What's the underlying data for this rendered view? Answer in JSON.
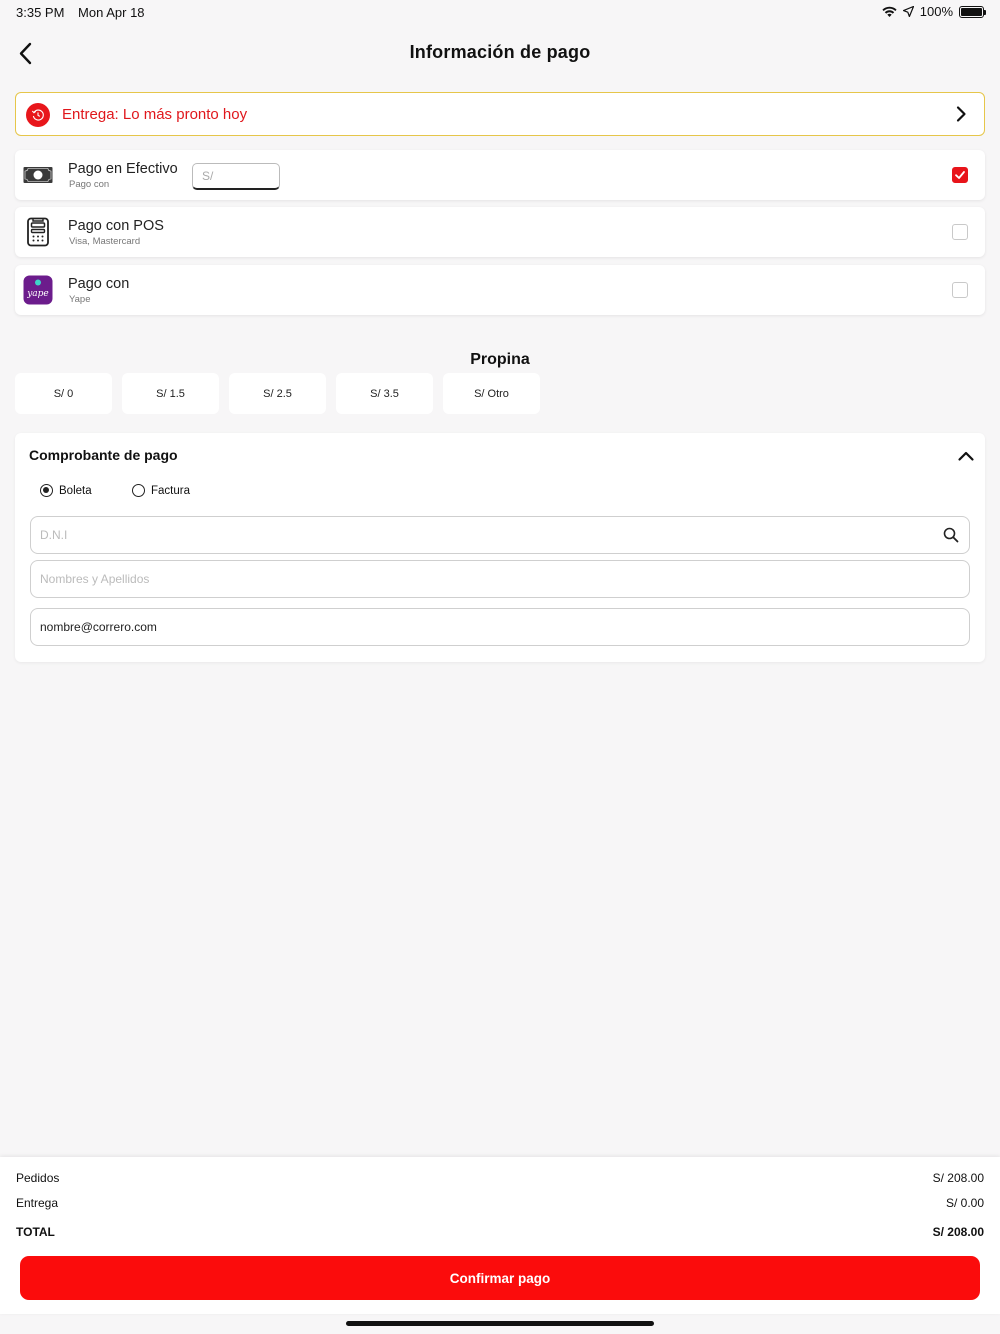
{
  "status": {
    "time": "3:35 PM",
    "date": "Mon Apr 18",
    "battery": "100%"
  },
  "nav": {
    "title": "Información de pago"
  },
  "delivery": {
    "label": "Entrega: Lo más pronto hoy"
  },
  "payment_methods": [
    {
      "title": "Pago en Efectivo",
      "subtitle": "Pago con",
      "checked": true,
      "input_placeholder": "S/"
    },
    {
      "title": "Pago con POS",
      "subtitle": "Visa, Mastercard",
      "checked": false
    },
    {
      "title": "Pago con",
      "subtitle": "Yape",
      "checked": false
    }
  ],
  "tip": {
    "title": "Propina",
    "options": [
      "S/ 0",
      "S/ 1.5",
      "S/ 2.5",
      "S/ 3.5",
      "S/ Otro"
    ]
  },
  "receipt": {
    "title": "Comprobante de pago",
    "options": [
      "Boleta",
      "Factura"
    ],
    "selected": "Boleta",
    "dni_placeholder": "D.N.I",
    "name_placeholder": "Nombres y Apellidos",
    "email_value": "nombre@correro.com"
  },
  "summary": {
    "orders_label": "Pedidos",
    "orders_value": "S/ 208.00",
    "delivery_label": "Entrega",
    "delivery_value": "S/ 0.00",
    "total_label": "TOTAL",
    "total_value": "S/ 208.00",
    "confirm_label": "Confirmar pago"
  },
  "colors": {
    "accent": "#fb0c0c",
    "delivery_border": "#e6c64a",
    "yape": "#6c1c8c"
  }
}
